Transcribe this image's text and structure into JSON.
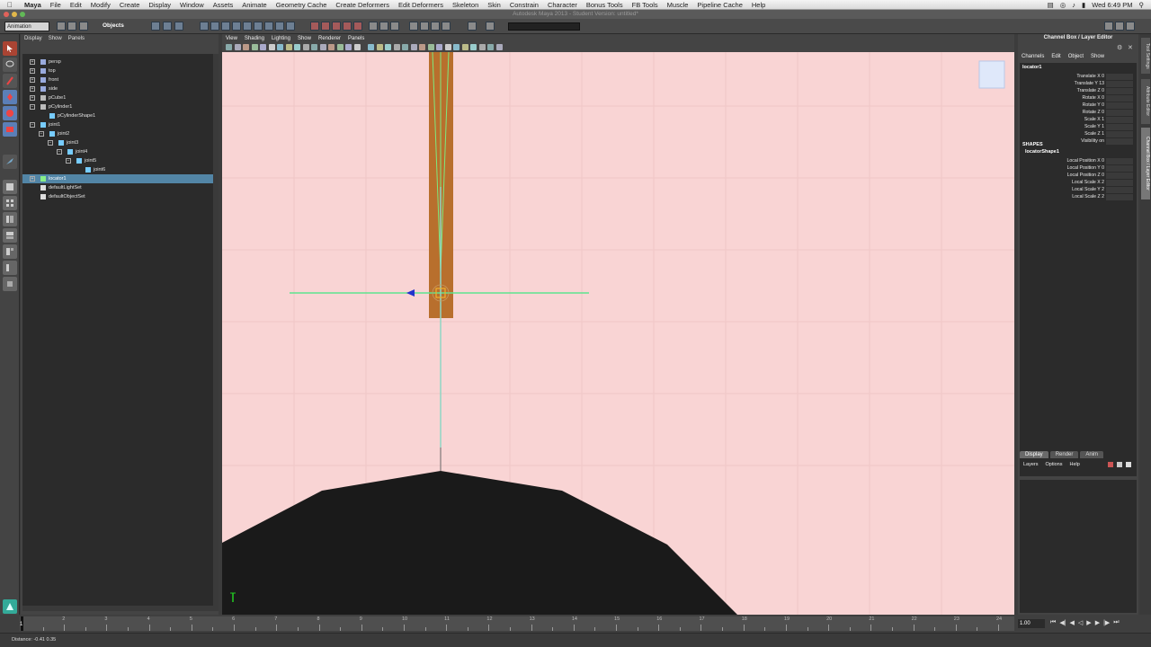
{
  "menubar": {
    "apple": "",
    "items": [
      "Maya",
      "File",
      "Edit",
      "Modify",
      "Create",
      "Display",
      "Window",
      "Assets",
      "Animate",
      "Geometry Cache",
      "Create Deformers",
      "Edit Deformers",
      "Skeleton",
      "Skin",
      "Constrain",
      "Character",
      "Bonus Tools",
      "FB Tools",
      "Muscle",
      "Pipeline Cache",
      "Help"
    ],
    "clock": "Wed 6:49 PM"
  },
  "window": {
    "title": "Autodesk Maya 2013 - Student Version: untitled*"
  },
  "statusline": {
    "mode": "Animation",
    "objects_label": "Objects"
  },
  "outliner": {
    "menu": [
      "Display",
      "Show",
      "Panels"
    ],
    "items": [
      {
        "label": "persp",
        "indent": 0,
        "expander": "+",
        "icon": "camera"
      },
      {
        "label": "top",
        "indent": 0,
        "expander": "+",
        "icon": "camera"
      },
      {
        "label": "front",
        "indent": 0,
        "expander": "+",
        "icon": "camera"
      },
      {
        "label": "side",
        "indent": 0,
        "expander": "+",
        "icon": "camera"
      },
      {
        "label": "pCube1",
        "indent": 0,
        "expander": "+",
        "icon": "mesh"
      },
      {
        "label": "pCylinder1",
        "indent": 0,
        "expander": "−",
        "icon": "mesh"
      },
      {
        "label": "pCylinderShape1",
        "indent": 1,
        "expander": "",
        "icon": "shape"
      },
      {
        "label": "joint1",
        "indent": 0,
        "expander": "−",
        "icon": "joint"
      },
      {
        "label": "joint2",
        "indent": 1,
        "expander": "−",
        "icon": "joint"
      },
      {
        "label": "joint3",
        "indent": 2,
        "expander": "−",
        "icon": "joint"
      },
      {
        "label": "joint4",
        "indent": 3,
        "expander": "−",
        "icon": "joint"
      },
      {
        "label": "joint5",
        "indent": 4,
        "expander": "−",
        "icon": "joint"
      },
      {
        "label": "joint6",
        "indent": 5,
        "expander": "",
        "icon": "joint"
      },
      {
        "label": "locator1",
        "indent": 0,
        "expander": "+",
        "icon": "locator",
        "selected": true
      },
      {
        "label": "defaultLightSet",
        "indent": 0,
        "expander": "",
        "icon": "set"
      },
      {
        "label": "defaultObjectSet",
        "indent": 0,
        "expander": "",
        "icon": "set"
      }
    ]
  },
  "viewport": {
    "menu": [
      "View",
      "Shading",
      "Lighting",
      "Show",
      "Renderer",
      "Panels"
    ],
    "background": "#f9d4d4"
  },
  "channelbox": {
    "title": "Channel Box / Layer Editor",
    "menu": [
      "Channels",
      "Edit",
      "Object",
      "Show"
    ],
    "object": "locator1",
    "attributes": [
      "Translate X 0",
      "Translate Y 13",
      "Translate Z 0",
      "Rotate X 0",
      "Rotate Y 0",
      "Rotate Z 0",
      "Scale X 1",
      "Scale Y 1",
      "Scale Z 1",
      "Visibility on"
    ],
    "shapes_label": "SHAPES",
    "shape_name": "locatorShape1",
    "shape_attributes": [
      "Local Position X 0",
      "Local Position Y 0",
      "Local Position Z 0",
      "Local Scale X 2",
      "Local Scale Y 2",
      "Local Scale Z 2"
    ],
    "layer_tabs": [
      "Display",
      "Render",
      "Anim"
    ],
    "layer_menu": [
      "Layers",
      "Options",
      "Help"
    ]
  },
  "sidetabs": [
    "Tool Settings",
    "Attribute Editor",
    "Channel Box / Layer Editor"
  ],
  "timeslider": {
    "ticks": [
      "1",
      "2",
      "3",
      "4",
      "5",
      "6",
      "7",
      "8",
      "9",
      "10",
      "11",
      "12",
      "13",
      "14",
      "15",
      "16",
      "17",
      "18",
      "19",
      "20",
      "21",
      "22",
      "23",
      "24"
    ],
    "current": "1",
    "frame_field": "1.00"
  },
  "helpline": {
    "text": "Distance: -0.41      0.35"
  }
}
